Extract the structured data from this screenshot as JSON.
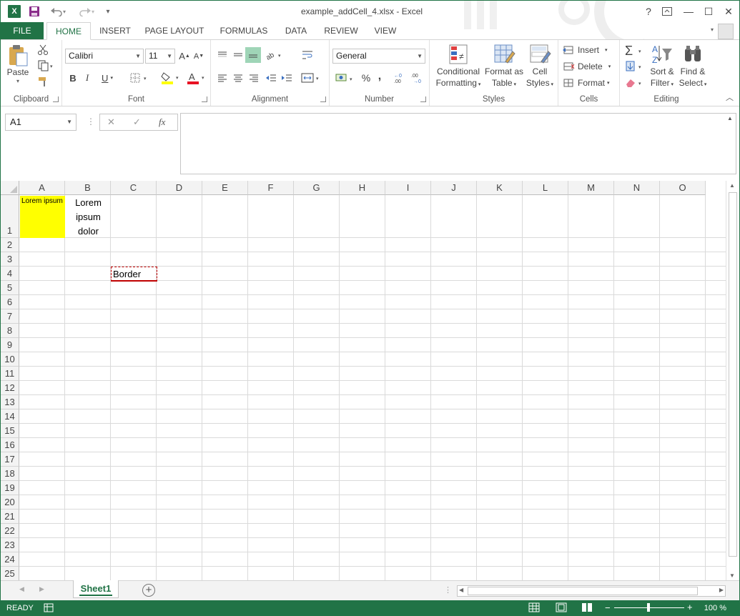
{
  "window": {
    "title": "example_addCell_4.xlsx - Excel",
    "help": "?",
    "minimize": "—",
    "maximize": "☐",
    "close": "✕"
  },
  "qat": {
    "app_logo": "X",
    "save_icon": "save-icon",
    "undo_icon": "undo-icon",
    "redo_icon": "redo-icon",
    "customize": "▾"
  },
  "tabs": [
    "FILE",
    "HOME",
    "INSERT",
    "PAGE LAYOUT",
    "FORMULAS",
    "DATA",
    "REVIEW",
    "VIEW"
  ],
  "ribbon": {
    "clipboard": {
      "label": "Clipboard",
      "paste": "Paste"
    },
    "font": {
      "label": "Font",
      "name": "Calibri",
      "size": "11",
      "bold": "B",
      "italic": "I",
      "underline": "U",
      "grow": "A",
      "shrink": "A",
      "font_color_swatch": "#e81123",
      "highlight_swatch": "#ffff00"
    },
    "alignment": {
      "label": "Alignment"
    },
    "number": {
      "label": "Number",
      "format": "General",
      "percent": "%",
      "comma": ","
    },
    "styles": {
      "label": "Styles",
      "conditional": [
        "Conditional",
        "Formatting"
      ],
      "format_table": [
        "Format as",
        "Table"
      ],
      "cell_styles": [
        "Cell",
        "Styles"
      ]
    },
    "cells": {
      "label": "Cells",
      "insert": "Insert",
      "delete": "Delete",
      "format": "Format"
    },
    "editing": {
      "label": "Editing",
      "sort": [
        "Sort &",
        "Filter"
      ],
      "find": [
        "Find &",
        "Select"
      ]
    }
  },
  "formula_bar": {
    "name_box": "A1",
    "cancel": "✕",
    "enter": "✓",
    "fx": "fx",
    "value": ""
  },
  "columns": [
    "A",
    "B",
    "C",
    "D",
    "E",
    "F",
    "G",
    "H",
    "I",
    "J",
    "K",
    "L",
    "M",
    "N",
    "O"
  ],
  "rows": [
    "1",
    "2",
    "3",
    "4",
    "5",
    "6",
    "7",
    "8",
    "9",
    "10",
    "11",
    "12",
    "13",
    "14",
    "15",
    "16",
    "17",
    "18",
    "19",
    "20",
    "21",
    "22",
    "23",
    "24",
    "25"
  ],
  "cells": {
    "A1": {
      "text": "Lorem ipsum",
      "fill": "#ffff00"
    },
    "B1": {
      "lines": [
        "Lorem",
        "ipsum",
        "dolor"
      ]
    },
    "C4": {
      "text": "Border",
      "border_color": "#c00000"
    }
  },
  "sheets": [
    "Sheet1"
  ],
  "status": {
    "ready": "READY",
    "zoom": "100 %",
    "minus": "−",
    "plus": "+"
  }
}
